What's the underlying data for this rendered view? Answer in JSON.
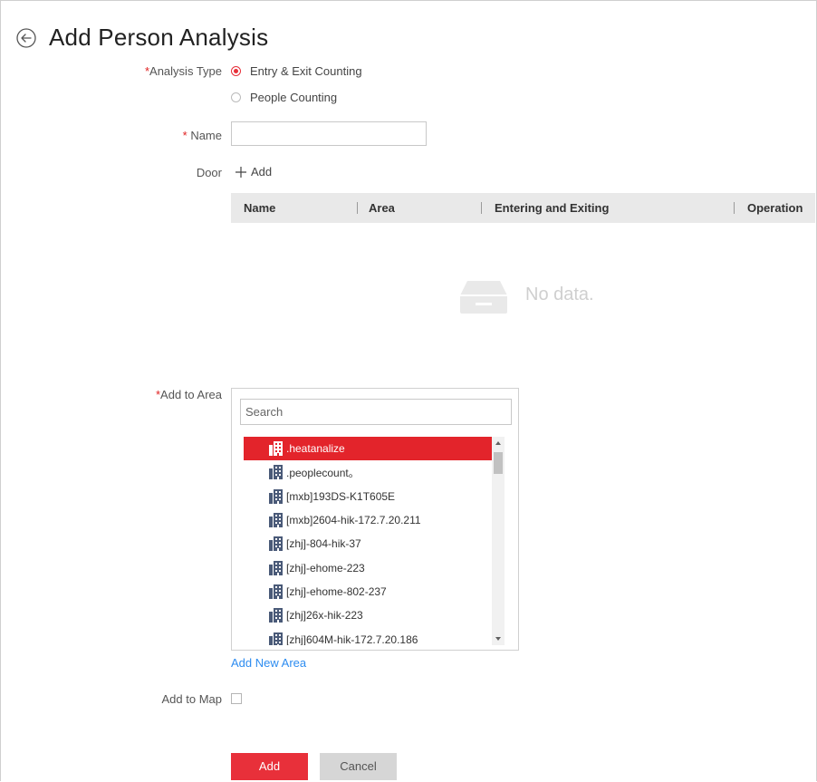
{
  "page": {
    "title": "Add Person Analysis"
  },
  "form": {
    "analysis_type": {
      "label": "Analysis Type",
      "options": [
        {
          "label": "Entry & Exit Counting",
          "selected": true
        },
        {
          "label": "People Counting",
          "selected": false
        }
      ]
    },
    "name": {
      "label": "Name",
      "value": ""
    },
    "door": {
      "label": "Door",
      "add_label": "Add"
    },
    "table": {
      "columns": [
        "Name",
        "Area",
        "Entering and Exiting",
        "Operation"
      ],
      "rows": [],
      "empty_text": "No data."
    },
    "add_to_area": {
      "label": "Add to Area",
      "search_placeholder": "Search",
      "items": [
        ".heatanalize",
        ".peoplecount。",
        "[mxb]193DS-K1T605E",
        "[mxb]2604-hik-172.7.20.211",
        "[zhj]-804-hik-37",
        "[zhj]-ehome-223",
        "[zhj]-ehome-802-237",
        "[zhj]26x-hik-223",
        "[zhj]604M-hik-172.7.20.186"
      ],
      "selected_index": 0,
      "add_new_link": "Add New Area"
    },
    "add_to_map": {
      "label": "Add to Map",
      "checked": false
    }
  },
  "buttons": {
    "add": "Add",
    "cancel": "Cancel"
  },
  "colors": {
    "accent": "#e8303a",
    "selected_row": "#e3242b",
    "link": "#2d8cf0",
    "table_header": "#e9e9e9"
  }
}
